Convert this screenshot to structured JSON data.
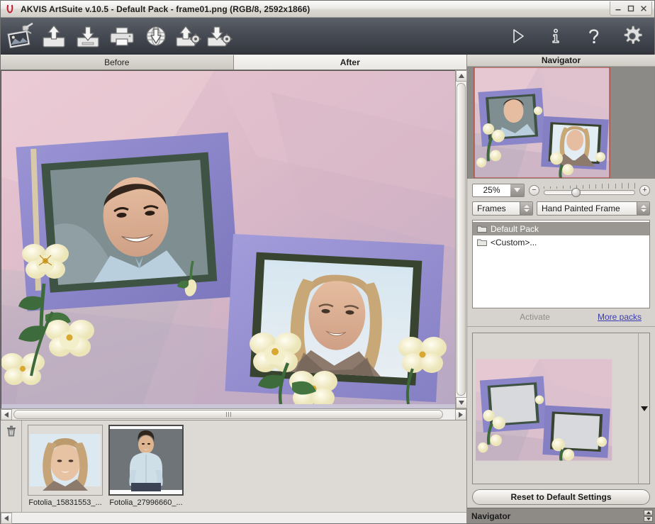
{
  "window": {
    "title": "AKVIS ArtSuite v.10.5 - Default Pack - frame01.png (RGB/8, 2592x1866)",
    "logo_icon": "akvis-horseshoe-logo",
    "minimize_label": "Minimize",
    "maximize_label": "Maximize",
    "close_label": "Close"
  },
  "toolbar": {
    "left_items": [
      {
        "name": "artsuite-logo-icon",
        "label": "AKVIS ArtSuite"
      },
      {
        "name": "open-image-icon",
        "label": "Open Image"
      },
      {
        "name": "save-image-icon",
        "label": "Save Image"
      },
      {
        "name": "print-image-icon",
        "label": "Print Image"
      },
      {
        "name": "publish-web-icon",
        "label": "Publish Image to Web"
      },
      {
        "name": "load-preset-icon",
        "label": "Load Preset"
      },
      {
        "name": "save-preset-icon",
        "label": "Save Preset"
      }
    ],
    "right_items": [
      {
        "name": "run-icon",
        "label": "Run"
      },
      {
        "name": "info-icon",
        "label": "About the Program"
      },
      {
        "name": "help-icon",
        "label": "Help"
      },
      {
        "name": "preferences-gear-icon",
        "label": "Preferences"
      }
    ]
  },
  "tabs": {
    "before": "Before",
    "after": "After",
    "active": "After"
  },
  "navigator": {
    "header": "Navigator",
    "zoom_value": "25%",
    "zoom_out_label": "−",
    "zoom_in_label": "+",
    "slider_position_pct": 30
  },
  "effect": {
    "category": "Frames",
    "frame_name": "Hand Painted Frame"
  },
  "packs": {
    "items": [
      {
        "label": "Default Pack",
        "selected": true
      },
      {
        "label": "<Custom>...",
        "selected": false
      }
    ],
    "activate_label": "Activate",
    "more_packs_label": "More packs",
    "more_packs_color": "#3b3bb0"
  },
  "preview": {
    "scroll_down_label": "Scroll down"
  },
  "footer": {
    "reset_label": "Reset to Default Settings",
    "status_text": "Navigator"
  },
  "filmstrip": {
    "delete_label": "Delete",
    "items": [
      {
        "label": "Fotolia_15831553_...",
        "selected": false
      },
      {
        "label": "Fotolia_27996660_...",
        "selected": true
      }
    ]
  },
  "colors": {
    "toolbar_bg": "#4b4f57",
    "panel_bg": "#d6d3ce",
    "selection": "#9a9792",
    "viewport_marker": "#c0392b",
    "link": "#3b3bb0",
    "statusbar": "#8e8b86"
  }
}
